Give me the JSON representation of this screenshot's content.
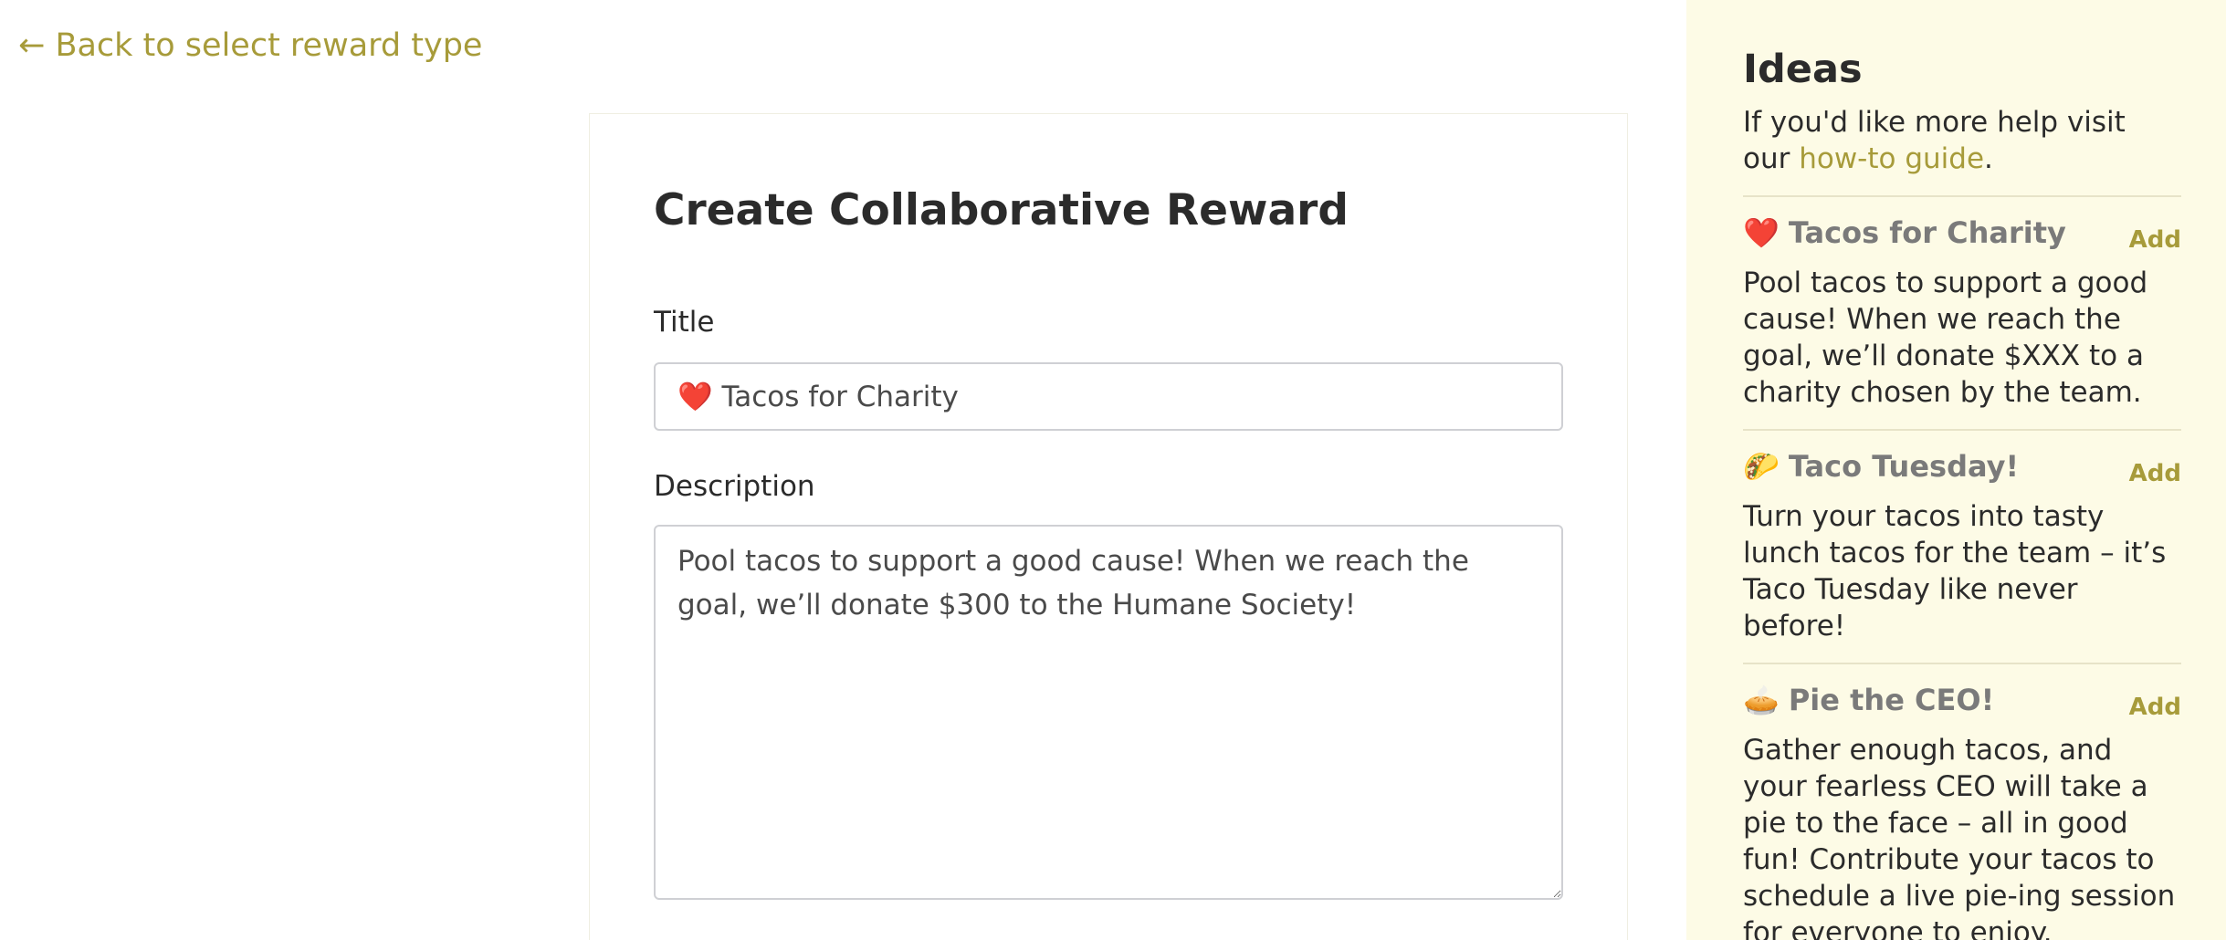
{
  "main": {
    "back_link": "← Back to select reward type",
    "form": {
      "title": "Create Collaborative Reward",
      "title_label": "Title",
      "title_value": "❤️ Tacos for Charity",
      "description_label": "Description",
      "description_value": "Pool tacos to support a good cause! When we reach the goal, we’ll donate $300 to the Humane Society!"
    }
  },
  "sidebar": {
    "heading": "Ideas",
    "help_prefix": "If you'd like more help visit our ",
    "help_link": "how-to guide",
    "help_suffix": ".",
    "ideas": [
      {
        "emoji": "❤️",
        "title": "Tacos for Charity",
        "add_label": "Add",
        "description": "Pool tacos to support a good cause! When we reach the goal, we’ll donate $XXX to a charity chosen by the team."
      },
      {
        "emoji": "🌮",
        "title": "Taco Tuesday!",
        "add_label": "Add",
        "description": "Turn your tacos into tasty lunch tacos for the team – it’s Taco Tuesday like never before!"
      },
      {
        "emoji": "🥧",
        "title": "Pie the CEO!",
        "add_label": "Add",
        "description": "Gather enough tacos, and your fearless CEO will take a pie to the face – all in good fun! Contribute your tacos to schedule a live pie-ing session for everyone to enjoy."
      }
    ]
  },
  "colors": {
    "accent": "#a79b3a",
    "sidebar_background": "#fdfbe6",
    "text": "#2b2b2b",
    "idea_title": "#7a7a7a"
  }
}
